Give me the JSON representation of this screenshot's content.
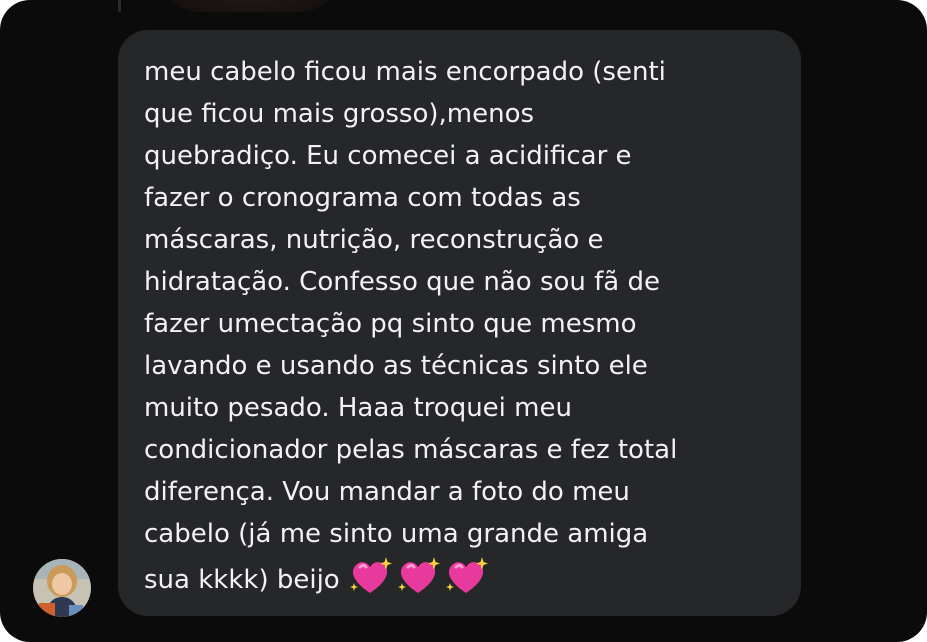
{
  "conversation": {
    "message": {
      "text": "meu cabelo ficou mais encorpado (senti\nque ficou mais grosso),menos\nquebradiço. Eu comecei a acidificar e\nfazer o cronograma com todas as\nmáscaras, nutrição, reconstrução e\nhidratação. Confesso que não sou fã de\nfazer umectação pq sinto que mesmo\nlavando e usando as técnicas sinto ele\nmuito pesado. Haaa troquei meu\ncondicionador pelas máscaras e fez total\ndiferença. Vou mandar a foto do meu\ncabelo (já me sinto uma grande amiga\nsua kkkk) beijo",
      "emoji_count": 3,
      "emoji_icon": "sparkling-heart-icon"
    },
    "sender": {
      "avatar_icon": "profile-photo-avatar"
    }
  },
  "colors": {
    "background": "#0b0b0c",
    "bubble": "#262729",
    "text": "#f2f2f4",
    "heart": "#e83a9c"
  }
}
